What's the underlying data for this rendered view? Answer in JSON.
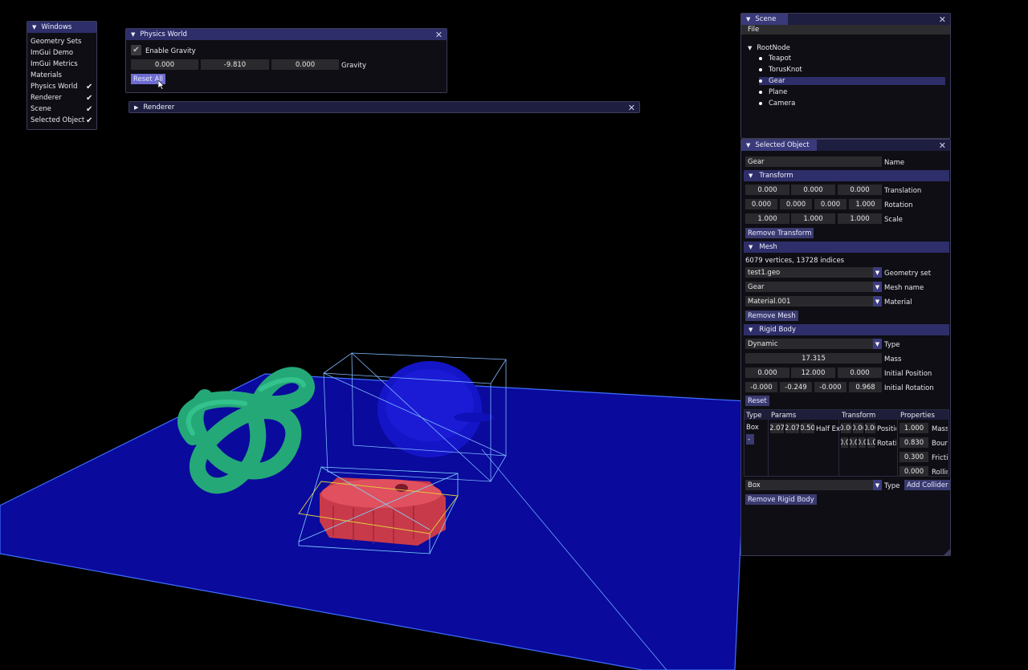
{
  "windows_menu": {
    "title": "Windows",
    "items": [
      {
        "label": "Geometry Sets",
        "checked": false
      },
      {
        "label": "ImGui Demo",
        "checked": false
      },
      {
        "label": "ImGui Metrics",
        "checked": false
      },
      {
        "label": "Materials",
        "checked": false
      },
      {
        "label": "Physics World",
        "checked": true
      },
      {
        "label": "Renderer",
        "checked": true
      },
      {
        "label": "Scene",
        "checked": true
      },
      {
        "label": "Selected Object",
        "checked": true
      }
    ]
  },
  "physics_world": {
    "title": "Physics World",
    "enable_gravity_label": "Enable Gravity",
    "enable_gravity": true,
    "gravity": [
      "0.000",
      "-9.810",
      "0.000"
    ],
    "gravity_label": "Gravity",
    "reset_all_label": "Reset All"
  },
  "renderer": {
    "title": "Renderer"
  },
  "scene": {
    "title": "Scene",
    "menu_file": "File",
    "root": "RootNode",
    "children": [
      "Teapot",
      "TorusKnot",
      "Gear",
      "Plane",
      "Camera"
    ],
    "selected": "Gear"
  },
  "selected_object": {
    "title": "Selected Object",
    "name_value": "Gear",
    "name_label": "Name",
    "transform": {
      "header": "Transform",
      "translation": [
        "0.000",
        "0.000",
        "0.000"
      ],
      "translation_label": "Translation",
      "rotation": [
        "0.000",
        "0.000",
        "0.000",
        "1.000"
      ],
      "rotation_label": "Rotation",
      "scale": [
        "1.000",
        "1.000",
        "1.000"
      ],
      "scale_label": "Scale",
      "remove_label": "Remove Transform"
    },
    "mesh": {
      "header": "Mesh",
      "info": "6079 vertices, 13728 indices",
      "geometry_set": "test1.geo",
      "geometry_set_label": "Geometry set",
      "mesh_name": "Gear",
      "mesh_name_label": "Mesh name",
      "material": "Material.001",
      "material_label": "Material",
      "remove_label": "Remove Mesh"
    },
    "rigid_body": {
      "header": "Rigid Body",
      "type": "Dynamic",
      "type_label": "Type",
      "mass": "17.315",
      "mass_label": "Mass",
      "initial_position": [
        "0.000",
        "12.000",
        "0.000"
      ],
      "initial_position_label": "Initial Position",
      "initial_rotation": [
        "-0.000",
        "-0.249",
        "-0.000",
        "0.968"
      ],
      "initial_rotation_label": "Initial Rotation",
      "reset_label": "Reset",
      "table_headers": [
        "Type",
        "Params",
        "Transform",
        "Properties"
      ],
      "collider_type": "Box",
      "collider_remove": "-",
      "params": [
        "2.07",
        "2.07",
        "0.50"
      ],
      "params_label": "Half Ext",
      "transform_pos": [
        "0.0(",
        "0.0(",
        "0.0("
      ],
      "transform_pos_label": "Positic",
      "transform_rot": [
        "0.0",
        "0.0",
        "0.0",
        "1.0"
      ],
      "transform_rot_label": "Rotatio",
      "properties": [
        {
          "value": "1.000",
          "label": "Mass"
        },
        {
          "value": "0.830",
          "label": "Boun"
        },
        {
          "value": "0.300",
          "label": "Fricti"
        },
        {
          "value": "0.000",
          "label": "Rollir"
        }
      ],
      "new_collider_type": "Box",
      "new_collider_type_label": "Type",
      "add_collider_label": "Add Collider",
      "remove_label": "Remove Rigid Body"
    }
  }
}
